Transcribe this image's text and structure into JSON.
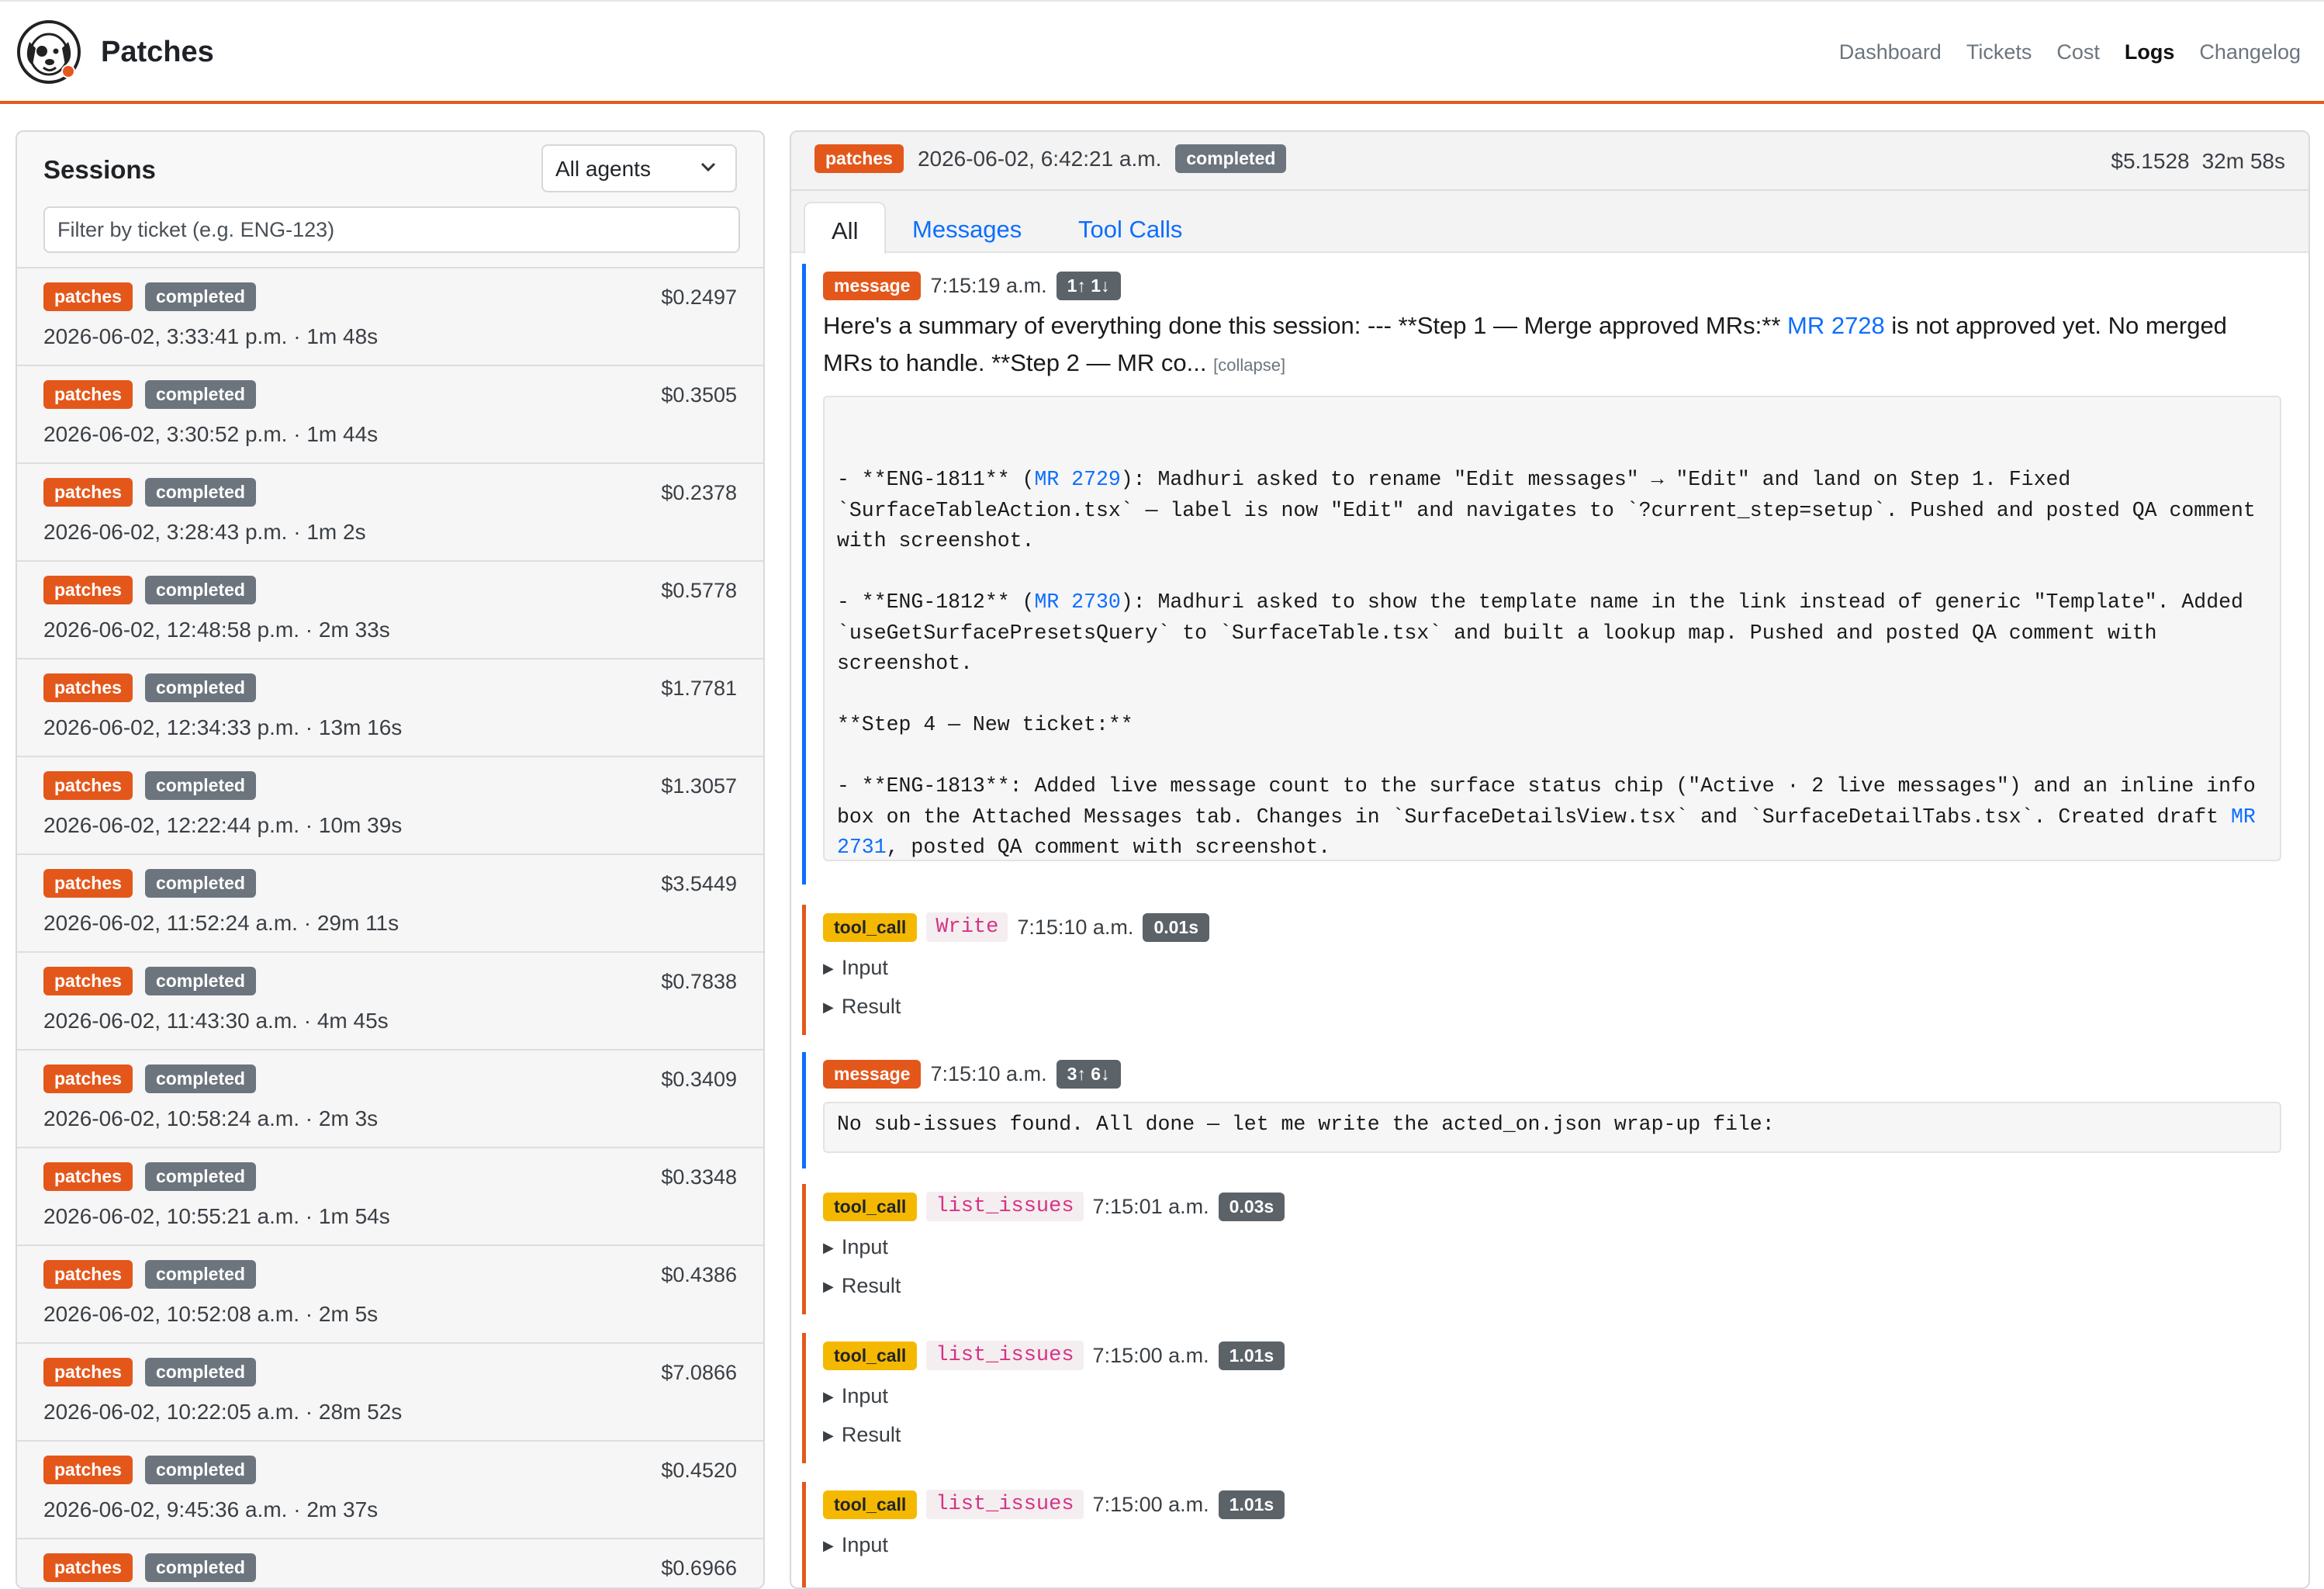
{
  "app": {
    "name": "Patches"
  },
  "nav": [
    "Dashboard",
    "Tickets",
    "Cost",
    "Logs",
    "Changelog"
  ],
  "nav_active": "Logs",
  "sessions_panel": {
    "title": "Sessions",
    "agent_select": "All agents",
    "filter_placeholder": "Filter by ticket (e.g. ENG-123)",
    "rows": [
      {
        "agent": "patches",
        "status": "completed",
        "cost": "$0.2497",
        "meta": "2026-06-02, 3:33:41 p.m. · 1m 48s"
      },
      {
        "agent": "patches",
        "status": "completed",
        "cost": "$0.3505",
        "meta": "2026-06-02, 3:30:52 p.m. · 1m 44s"
      },
      {
        "agent": "patches",
        "status": "completed",
        "cost": "$0.2378",
        "meta": "2026-06-02, 3:28:43 p.m. · 1m 2s"
      },
      {
        "agent": "patches",
        "status": "completed",
        "cost": "$0.5778",
        "meta": "2026-06-02, 12:48:58 p.m. · 2m 33s"
      },
      {
        "agent": "patches",
        "status": "completed",
        "cost": "$1.7781",
        "meta": "2026-06-02, 12:34:33 p.m. · 13m 16s"
      },
      {
        "agent": "patches",
        "status": "completed",
        "cost": "$1.3057",
        "meta": "2026-06-02, 12:22:44 p.m. · 10m 39s"
      },
      {
        "agent": "patches",
        "status": "completed",
        "cost": "$3.5449",
        "meta": "2026-06-02, 11:52:24 a.m. · 29m 11s"
      },
      {
        "agent": "patches",
        "status": "completed",
        "cost": "$0.7838",
        "meta": "2026-06-02, 11:43:30 a.m. · 4m 45s"
      },
      {
        "agent": "patches",
        "status": "completed",
        "cost": "$0.3409",
        "meta": "2026-06-02, 10:58:24 a.m. · 2m 3s"
      },
      {
        "agent": "patches",
        "status": "completed",
        "cost": "$0.3348",
        "meta": "2026-06-02, 10:55:21 a.m. · 1m 54s"
      },
      {
        "agent": "patches",
        "status": "completed",
        "cost": "$0.4386",
        "meta": "2026-06-02, 10:52:08 a.m. · 2m 5s"
      },
      {
        "agent": "patches",
        "status": "completed",
        "cost": "$7.0866",
        "meta": "2026-06-02, 10:22:05 a.m. · 28m 52s"
      },
      {
        "agent": "patches",
        "status": "completed",
        "cost": "$0.4520",
        "meta": "2026-06-02, 9:45:36 a.m. · 2m 37s"
      },
      {
        "agent": "patches",
        "status": "completed",
        "cost": "$0.6966",
        "meta": ""
      }
    ]
  },
  "log_panel": {
    "agent": "patches",
    "datetime": "2026-06-02, 6:42:21 a.m.",
    "status": "completed",
    "cost": "$5.1528",
    "duration": "32m 58s",
    "tabs": [
      "All",
      "Messages",
      "Tool Calls"
    ],
    "active_tab": "All",
    "entries": {
      "e1": {
        "type": "message",
        "time": "7:15:19 a.m.",
        "tokens": "1↑ 1↓",
        "summary_before": "Here's a summary of everything done this session: --- **Step 1 — Merge approved MRs:** ",
        "summary_link": "MR 2728",
        "summary_after": " is not approved yet. No merged MRs to handle. **Step 2 — MR co... ",
        "collapse_label": "[collapse]",
        "pre_cut": "  ",
        "lines": {
          "a1": "- **ENG-1811** (",
          "a_link": "MR 2729",
          "a2": "): Madhuri asked to rename \"Edit messages\" → \"Edit\" and land on Step 1. Fixed `SurfaceTableAction.tsx` — label is now \"Edit\" and navigates to `?current_step=setup`. Pushed and posted QA comment with screenshot.",
          "b1": "- **ENG-1812** (",
          "b_link": "MR 2730",
          "b2": "): Madhuri asked to show the template name in the link instead of generic \"Template\". Added `useGetSurfacePresetsQuery` to `SurfaceTable.tsx` and built a lookup map. Pushed and posted QA comment with screenshot.",
          "c": "**Step 4 — New ticket:**",
          "d1": "- **ENG-1813**: Added live message count to the surface status chip (\"Active · 2 live messages\") and an inline info box on the Attached Messages tab. Changes in `SurfaceDetailsView.tsx` and `SurfaceDetailTabs.tsx`. Created draft ",
          "d_link": "MR 2731",
          "d2": ", posted QA comment with screenshot."
        }
      },
      "e2": {
        "type": "tool_call",
        "tool": "Write",
        "time": "7:15:10 a.m.",
        "duration": "0.01s",
        "input": "Input",
        "result": "Result"
      },
      "e3": {
        "type": "message",
        "time": "7:15:10 a.m.",
        "tokens": "3↑ 6↓",
        "text": "No sub-issues found. All done — let me write the acted_on.json wrap-up file:"
      },
      "e4": {
        "type": "tool_call",
        "tool": "list_issues",
        "time": "7:15:01 a.m.",
        "duration": "0.03s",
        "input": "Input",
        "result": "Result"
      },
      "e5": {
        "type": "tool_call",
        "tool": "list_issues",
        "time": "7:15:00 a.m.",
        "duration": "1.01s",
        "input": "Input",
        "result": "Result"
      },
      "e6": {
        "type": "tool_call",
        "tool": "list_issues",
        "time": "7:15:00 a.m.",
        "duration": "1.01s",
        "input": "Input"
      }
    }
  },
  "colors": {
    "accent": "#e4571b",
    "link": "#0d6efd",
    "tool_badge": "#f5b800",
    "status": "#6c757d"
  },
  "icons": [
    "dog-logo-icon",
    "chevron-down-icon",
    "triangle-right-icon"
  ]
}
